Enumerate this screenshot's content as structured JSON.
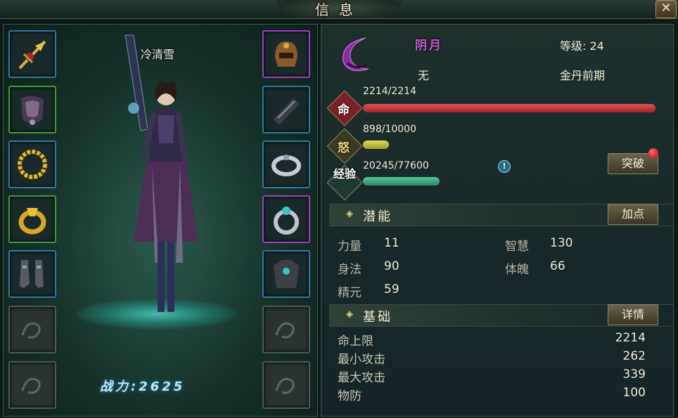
{
  "window": {
    "title": "信息",
    "close_label": "✕"
  },
  "character": {
    "name": "冷清雪",
    "power_label": "战力:2625"
  },
  "equipment_left": [
    {
      "name": "weapon-icon",
      "rarity": "blue"
    },
    {
      "name": "shoulder-armor-icon",
      "rarity": "green"
    },
    {
      "name": "necklace-icon",
      "rarity": "blue"
    },
    {
      "name": "ring-icon",
      "rarity": "green"
    },
    {
      "name": "boots-icon",
      "rarity": "blue"
    },
    {
      "name": "empty-slot",
      "rarity": "empty"
    },
    {
      "name": "empty-slot",
      "rarity": "empty"
    }
  ],
  "equipment_right": [
    {
      "name": "helmet-icon",
      "rarity": "purple"
    },
    {
      "name": "bracer-icon",
      "rarity": "blue"
    },
    {
      "name": "bracelet-icon",
      "rarity": "blue"
    },
    {
      "name": "ring-icon",
      "rarity": "purple"
    },
    {
      "name": "chest-armor-icon",
      "rarity": "blue"
    },
    {
      "name": "empty-slot",
      "rarity": "empty"
    },
    {
      "name": "empty-slot",
      "rarity": "empty"
    }
  ],
  "info": {
    "sect": "阴月",
    "level_label": "等级: 24",
    "guild": "无",
    "realm": "金丹前期"
  },
  "bars": {
    "hp": {
      "badge": "命",
      "text": "2214/2214",
      "fraction": 1.0,
      "color": "#c83a3a"
    },
    "rage": {
      "badge": "怒",
      "text": "898/10000",
      "fraction": 0.0898,
      "color": "#c8c043"
    },
    "exp": {
      "badge": "经验",
      "text": "20245/77600",
      "fraction": 0.2609,
      "color": "#3aa37a"
    }
  },
  "breakthrough_button": "突破",
  "potential": {
    "title": "潜能",
    "button": "加点",
    "stats": [
      {
        "label": "力量",
        "value": "11"
      },
      {
        "label": "智慧",
        "value": "130"
      },
      {
        "label": "身法",
        "value": "90"
      },
      {
        "label": "体魄",
        "value": "66"
      },
      {
        "label": "精元",
        "value": "59"
      }
    ]
  },
  "basic": {
    "title": "基础",
    "button": "详情",
    "stats": [
      {
        "label": "命上限",
        "value": "2214"
      },
      {
        "label": "最小攻击",
        "value": "262"
      },
      {
        "label": "最大攻击",
        "value": "339"
      },
      {
        "label": "物防",
        "value": "100"
      }
    ]
  }
}
